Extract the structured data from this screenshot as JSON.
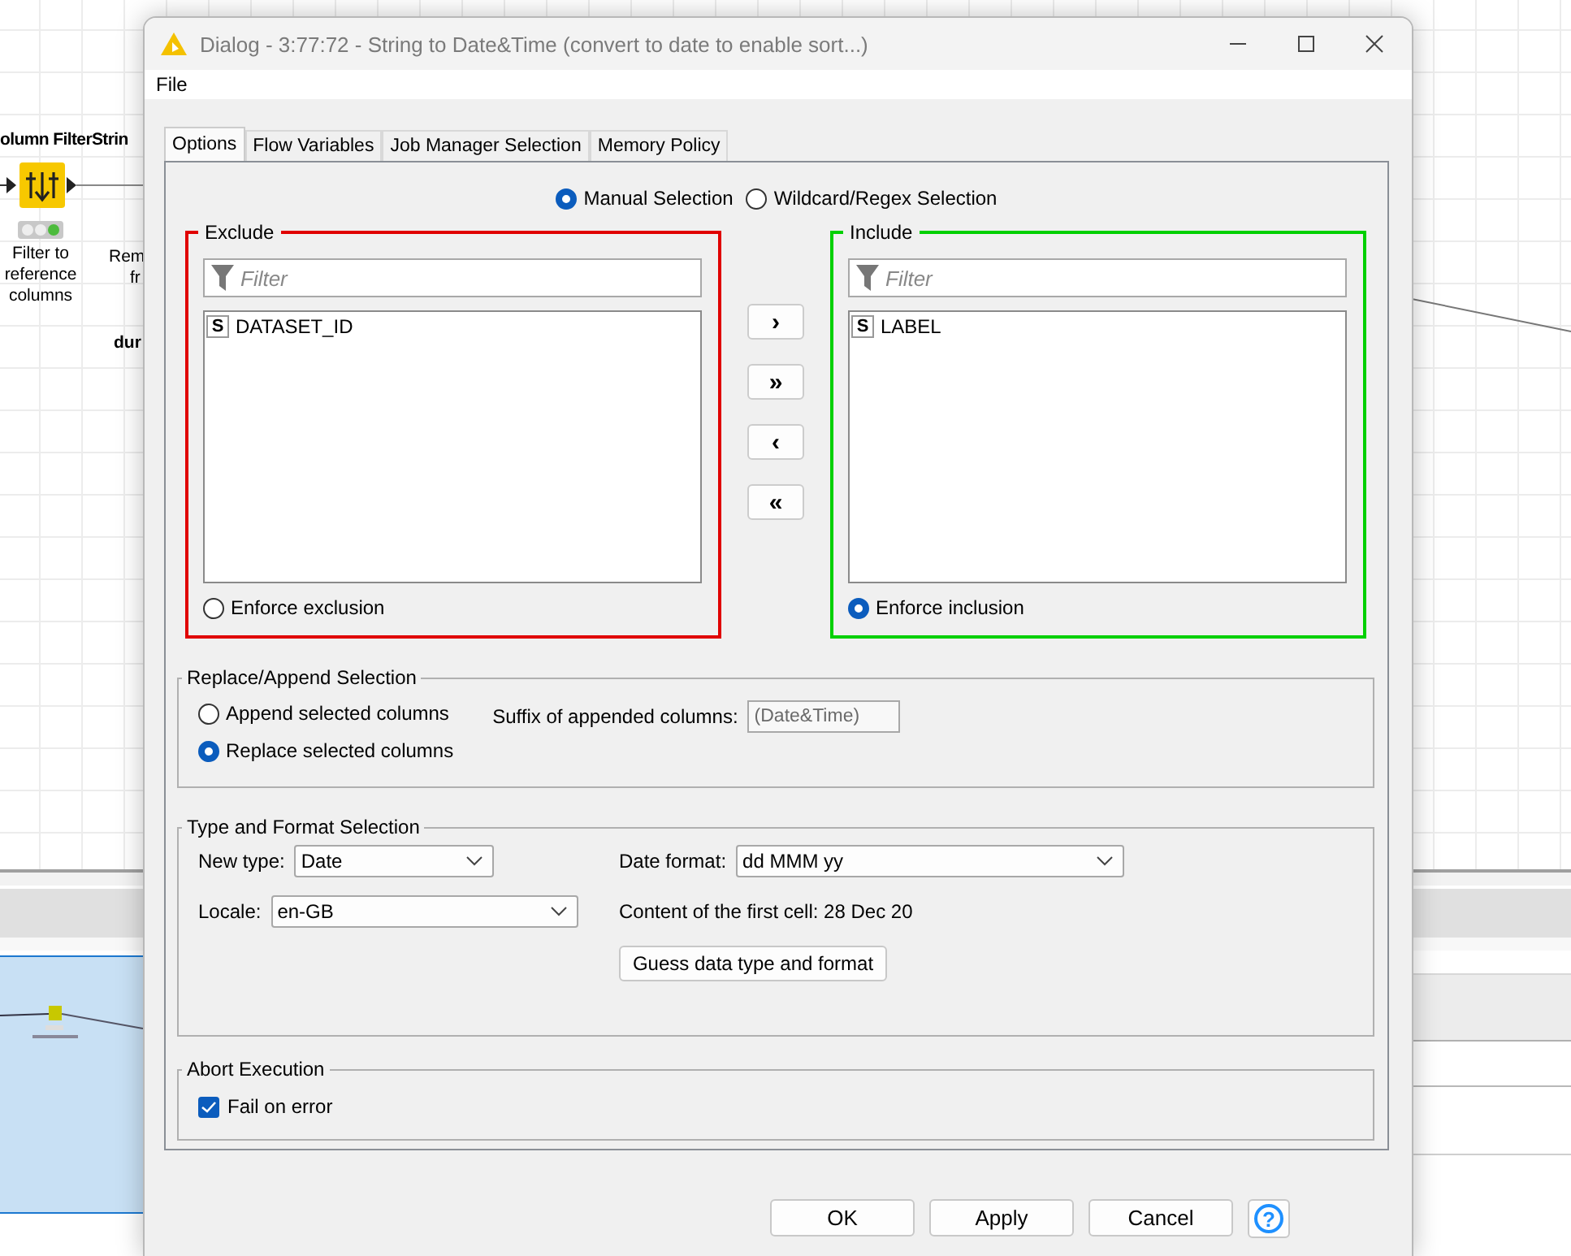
{
  "canvas": {
    "node": {
      "title": "olumn FilterStrin",
      "label": "Filter to reference columns"
    },
    "cut_labels": [
      {
        "text": "Rem"
      },
      {
        "text": "fr"
      },
      {
        "text": "dur"
      }
    ]
  },
  "dialog": {
    "title": "Dialog - 3:77:72 - String to Date&Time (convert to date to enable sort...)",
    "menu": [
      "File"
    ],
    "tabs": [
      {
        "label": "Options",
        "selected": true
      },
      {
        "label": "Flow Variables",
        "selected": false
      },
      {
        "label": "Job Manager Selection",
        "selected": false
      },
      {
        "label": "Memory Policy",
        "selected": false
      }
    ],
    "selection_modes": [
      {
        "label": "Manual Selection",
        "selected": true
      },
      {
        "label": "Wildcard/Regex Selection",
        "selected": false
      }
    ],
    "lists": [
      {
        "title": "Exclude",
        "color": "#e00000",
        "placeholder": "Filter",
        "columns": [
          {
            "type": "S",
            "name": "DATASET_ID"
          }
        ],
        "enforce": {
          "label": "Enforce exclusion",
          "selected": false
        }
      },
      {
        "title": "Include",
        "color": "#00d000",
        "placeholder": "Filter",
        "columns": [
          {
            "type": "S",
            "name": "LABEL"
          }
        ],
        "enforce": {
          "label": "Enforce inclusion",
          "selected": true
        }
      }
    ],
    "move_buttons": [
      "›",
      "»",
      "‹",
      "«"
    ],
    "replace_append": {
      "title": "Replace/Append Selection",
      "options": [
        {
          "label": "Append selected columns",
          "selected": false
        },
        {
          "label": "Replace selected columns",
          "selected": true
        }
      ],
      "suffix_label": "Suffix of appended columns:",
      "suffix": {
        "value": "(Date&Time)",
        "disabled": true
      }
    },
    "type_format": {
      "title": "Type and Format Selection",
      "new_type": {
        "label": "New type:",
        "value": "Date"
      },
      "locale": {
        "label": "Locale:",
        "value": "en-GB"
      },
      "date_format": {
        "label": "Date format:",
        "value": "dd MMM yy"
      },
      "first_cell": "Content of the first cell: 28 Dec 20",
      "guess_button": "Guess data type and format"
    },
    "abort": {
      "title": "Abort Execution",
      "fail_on_error": {
        "label": "Fail on error",
        "checked": true
      }
    },
    "buttons": [
      "OK",
      "Apply",
      "Cancel"
    ],
    "help": "?"
  }
}
